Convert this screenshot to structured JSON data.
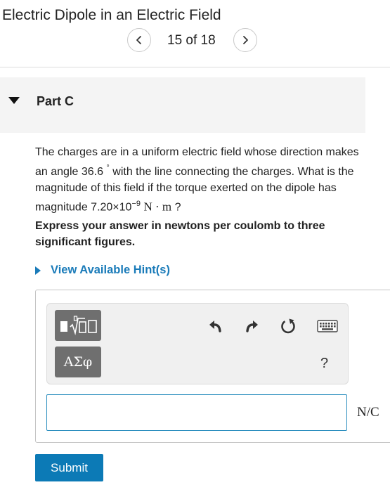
{
  "header": {
    "title": "Electric Dipole in an Electric Field",
    "page_counter": "15 of 18",
    "prev_icon": "chevron-left-icon",
    "next_icon": "chevron-right-icon"
  },
  "part": {
    "label": "Part C",
    "expanded": true
  },
  "question": {
    "text_before_angle": "The charges are in a uniform electric field whose direction makes an angle 36.6 ",
    "degree_symbol": "°",
    "text_after_angle": " with the line connecting the charges. What is the magnitude of this field if the torque exerted on the dipole has magnitude 7.20×10",
    "exponent": "−9",
    "unit": "N · m",
    "text_end": " ?"
  },
  "instruction": "Express your answer in newtons per coulomb to three significant figures.",
  "hint": {
    "label": "View Available Hint(s)"
  },
  "toolbar": {
    "templates_icon": "math-templates-icon",
    "greek_label": "ΑΣφ",
    "undo_icon": "undo-icon",
    "redo_icon": "redo-icon",
    "reset_icon": "reset-icon",
    "keyboard_icon": "keyboard-icon",
    "help_label": "?"
  },
  "answer": {
    "value": "",
    "unit": "N/C"
  },
  "submit": {
    "label": "Submit"
  },
  "colors": {
    "accent": "#0c7ab6",
    "link": "#1a7bb9",
    "input_border": "#2d8fbf",
    "tool_button": "#6f6f6f"
  }
}
